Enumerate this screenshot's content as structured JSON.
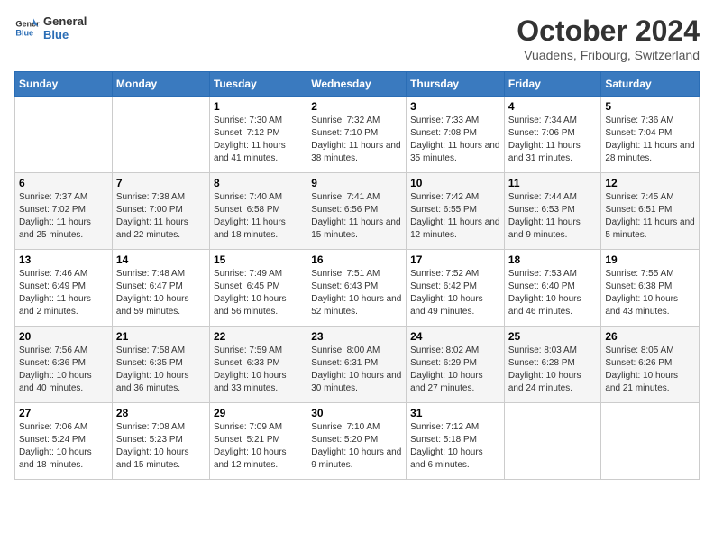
{
  "logo": {
    "line1": "General",
    "line2": "Blue"
  },
  "title": "October 2024",
  "location": "Vuadens, Fribourg, Switzerland",
  "days_of_week": [
    "Sunday",
    "Monday",
    "Tuesday",
    "Wednesday",
    "Thursday",
    "Friday",
    "Saturday"
  ],
  "weeks": [
    [
      {
        "day": "",
        "info": ""
      },
      {
        "day": "",
        "info": ""
      },
      {
        "day": "1",
        "info": "Sunrise: 7:30 AM\nSunset: 7:12 PM\nDaylight: 11 hours and 41 minutes."
      },
      {
        "day": "2",
        "info": "Sunrise: 7:32 AM\nSunset: 7:10 PM\nDaylight: 11 hours and 38 minutes."
      },
      {
        "day": "3",
        "info": "Sunrise: 7:33 AM\nSunset: 7:08 PM\nDaylight: 11 hours and 35 minutes."
      },
      {
        "day": "4",
        "info": "Sunrise: 7:34 AM\nSunset: 7:06 PM\nDaylight: 11 hours and 31 minutes."
      },
      {
        "day": "5",
        "info": "Sunrise: 7:36 AM\nSunset: 7:04 PM\nDaylight: 11 hours and 28 minutes."
      }
    ],
    [
      {
        "day": "6",
        "info": "Sunrise: 7:37 AM\nSunset: 7:02 PM\nDaylight: 11 hours and 25 minutes."
      },
      {
        "day": "7",
        "info": "Sunrise: 7:38 AM\nSunset: 7:00 PM\nDaylight: 11 hours and 22 minutes."
      },
      {
        "day": "8",
        "info": "Sunrise: 7:40 AM\nSunset: 6:58 PM\nDaylight: 11 hours and 18 minutes."
      },
      {
        "day": "9",
        "info": "Sunrise: 7:41 AM\nSunset: 6:56 PM\nDaylight: 11 hours and 15 minutes."
      },
      {
        "day": "10",
        "info": "Sunrise: 7:42 AM\nSunset: 6:55 PM\nDaylight: 11 hours and 12 minutes."
      },
      {
        "day": "11",
        "info": "Sunrise: 7:44 AM\nSunset: 6:53 PM\nDaylight: 11 hours and 9 minutes."
      },
      {
        "day": "12",
        "info": "Sunrise: 7:45 AM\nSunset: 6:51 PM\nDaylight: 11 hours and 5 minutes."
      }
    ],
    [
      {
        "day": "13",
        "info": "Sunrise: 7:46 AM\nSunset: 6:49 PM\nDaylight: 11 hours and 2 minutes."
      },
      {
        "day": "14",
        "info": "Sunrise: 7:48 AM\nSunset: 6:47 PM\nDaylight: 10 hours and 59 minutes."
      },
      {
        "day": "15",
        "info": "Sunrise: 7:49 AM\nSunset: 6:45 PM\nDaylight: 10 hours and 56 minutes."
      },
      {
        "day": "16",
        "info": "Sunrise: 7:51 AM\nSunset: 6:43 PM\nDaylight: 10 hours and 52 minutes."
      },
      {
        "day": "17",
        "info": "Sunrise: 7:52 AM\nSunset: 6:42 PM\nDaylight: 10 hours and 49 minutes."
      },
      {
        "day": "18",
        "info": "Sunrise: 7:53 AM\nSunset: 6:40 PM\nDaylight: 10 hours and 46 minutes."
      },
      {
        "day": "19",
        "info": "Sunrise: 7:55 AM\nSunset: 6:38 PM\nDaylight: 10 hours and 43 minutes."
      }
    ],
    [
      {
        "day": "20",
        "info": "Sunrise: 7:56 AM\nSunset: 6:36 PM\nDaylight: 10 hours and 40 minutes."
      },
      {
        "day": "21",
        "info": "Sunrise: 7:58 AM\nSunset: 6:35 PM\nDaylight: 10 hours and 36 minutes."
      },
      {
        "day": "22",
        "info": "Sunrise: 7:59 AM\nSunset: 6:33 PM\nDaylight: 10 hours and 33 minutes."
      },
      {
        "day": "23",
        "info": "Sunrise: 8:00 AM\nSunset: 6:31 PM\nDaylight: 10 hours and 30 minutes."
      },
      {
        "day": "24",
        "info": "Sunrise: 8:02 AM\nSunset: 6:29 PM\nDaylight: 10 hours and 27 minutes."
      },
      {
        "day": "25",
        "info": "Sunrise: 8:03 AM\nSunset: 6:28 PM\nDaylight: 10 hours and 24 minutes."
      },
      {
        "day": "26",
        "info": "Sunrise: 8:05 AM\nSunset: 6:26 PM\nDaylight: 10 hours and 21 minutes."
      }
    ],
    [
      {
        "day": "27",
        "info": "Sunrise: 7:06 AM\nSunset: 5:24 PM\nDaylight: 10 hours and 18 minutes."
      },
      {
        "day": "28",
        "info": "Sunrise: 7:08 AM\nSunset: 5:23 PM\nDaylight: 10 hours and 15 minutes."
      },
      {
        "day": "29",
        "info": "Sunrise: 7:09 AM\nSunset: 5:21 PM\nDaylight: 10 hours and 12 minutes."
      },
      {
        "day": "30",
        "info": "Sunrise: 7:10 AM\nSunset: 5:20 PM\nDaylight: 10 hours and 9 minutes."
      },
      {
        "day": "31",
        "info": "Sunrise: 7:12 AM\nSunset: 5:18 PM\nDaylight: 10 hours and 6 minutes."
      },
      {
        "day": "",
        "info": ""
      },
      {
        "day": "",
        "info": ""
      }
    ]
  ]
}
